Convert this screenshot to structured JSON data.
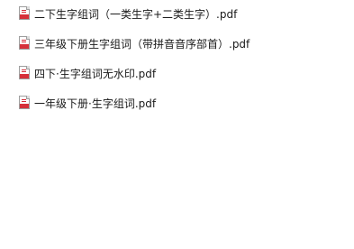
{
  "files": [
    {
      "name": "二下生字组词（一类生字+二类生字）.pdf",
      "icon": "pdf-file-icon"
    },
    {
      "name": "三年级下册生字组词（带拼音音序部首）.pdf",
      "icon": "pdf-file-icon"
    },
    {
      "name": "四下·生字组词无水印.pdf",
      "icon": "pdf-file-icon"
    },
    {
      "name": "一年级下册·生字组词.pdf",
      "icon": "pdf-file-icon"
    }
  ],
  "colors": {
    "background": "#ffffff",
    "text": "#1a1a1a",
    "pdf_accent": "#d6303a"
  }
}
